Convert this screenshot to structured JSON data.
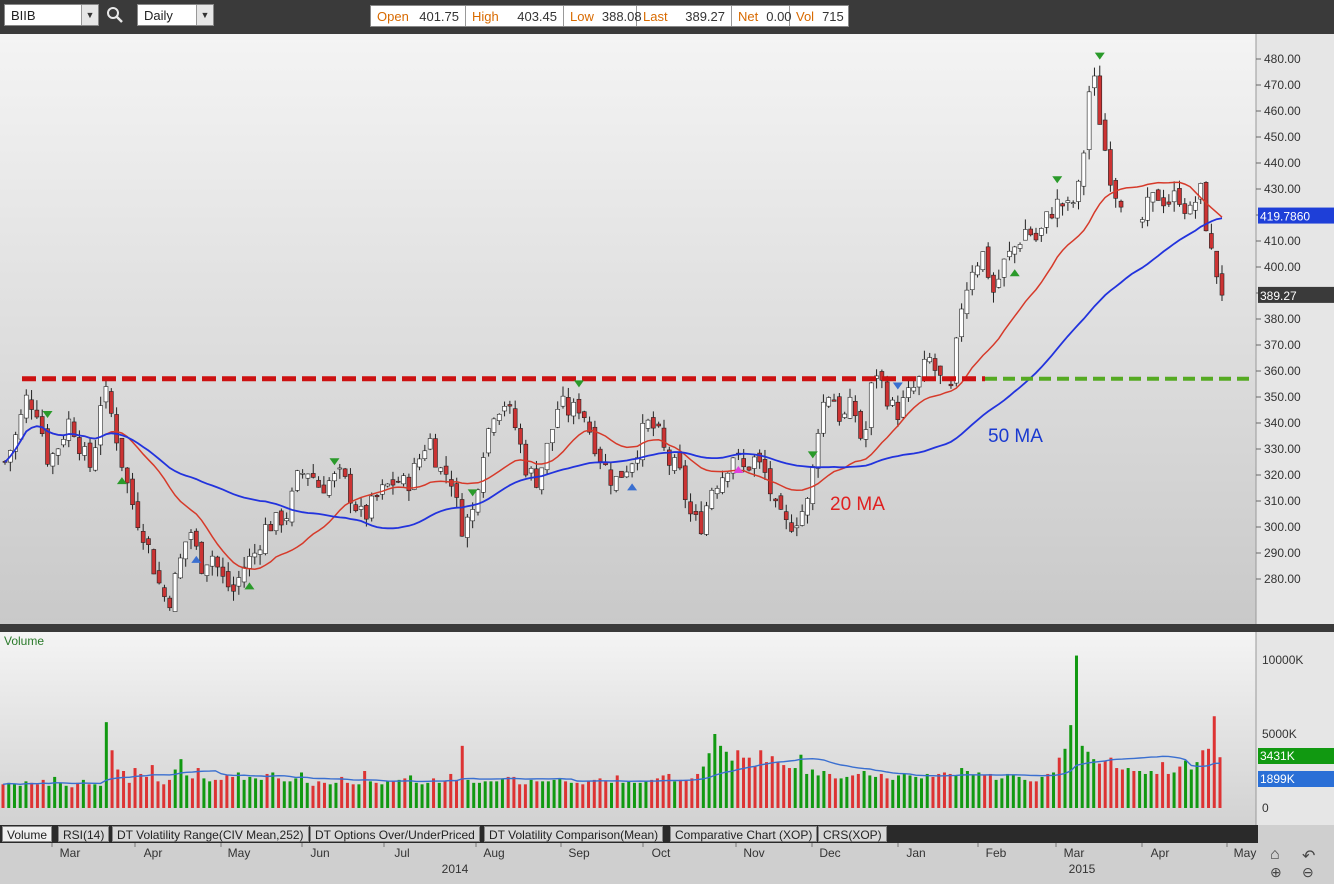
{
  "toolbar": {
    "symbol": "BIIB",
    "period": "Daily",
    "quote": [
      {
        "label": "Open",
        "value": "401.75"
      },
      {
        "label": "High",
        "value": "403.45"
      },
      {
        "label": "Low",
        "value": "388.08"
      },
      {
        "label": "Last",
        "value": "389.27"
      },
      {
        "label": "Net",
        "value": "0.00"
      },
      {
        "label": "Vol",
        "value": "715"
      }
    ]
  },
  "colors": {
    "up": "#ffffff",
    "down": "#cc3333",
    "ma20": "#d63a2a",
    "ma50": "#2233dd",
    "resistance": "#cc1111",
    "support": "#55aa22",
    "vol_up": "#119911",
    "vol_down": "#dd3333"
  },
  "tabs": [
    "Volume",
    "RSI(14)",
    "DT Volatility Range(CIV Mean,252)",
    "DT Options Over/UnderPriced",
    "DT Volatility Comparison(Mean)",
    "Comparative Chart (XOP)",
    "CRS(XOP)"
  ],
  "chart_data": [
    {
      "type": "candlestick",
      "title": "",
      "yaxis": {
        "ticks": [
          "480.00",
          "470.00",
          "460.00",
          "450.00",
          "440.00",
          "430.00",
          "420.00",
          "410.00",
          "400.00",
          "390.00",
          "380.00",
          "370.00",
          "360.00",
          "350.00",
          "340.00",
          "330.00",
          "320.00",
          "310.00",
          "300.00",
          "290.00",
          "280.00"
        ],
        "range": [
          270,
          486
        ]
      },
      "xaxis": {
        "months": [
          "Mar",
          "Apr",
          "May",
          "Jun",
          "Jul",
          "Aug",
          "Sep",
          "Oct",
          "Nov",
          "Dec",
          "Jan",
          "Feb",
          "Mar",
          "Apr",
          "May"
        ],
        "years": [
          "2014",
          "2015"
        ]
      },
      "price_labels": {
        "ma_value": "419.7860",
        "last": "389.27"
      },
      "annotations": {
        "ma20": "20 MA",
        "ma50": "50 MA"
      },
      "levels": {
        "resistance": 357,
        "support": 357
      },
      "path_points": [
        325,
        335,
        350,
        345,
        325,
        332,
        342,
        330,
        322,
        355,
        340,
        320,
        305,
        295,
        280,
        270,
        285,
        300,
        285,
        290,
        280,
        275,
        285,
        290,
        300,
        302,
        305,
        320,
        322,
        315,
        318,
        320,
        310,
        303,
        310,
        315,
        318,
        316,
        325,
        335,
        322,
        320,
        300,
        305,
        330,
        345,
        348,
        338,
        322,
        318,
        332,
        348,
        344,
        347,
        335,
        325,
        317,
        322,
        328,
        340,
        337,
        325,
        322,
        305,
        300,
        315,
        320,
        328,
        322,
        326,
        320,
        305,
        300,
        304,
        310,
        345,
        353,
        340,
        348,
        330,
        362,
        352,
        343,
        350,
        355,
        365,
        357,
        350,
        385,
        400,
        405,
        390,
        402,
        408,
        415,
        410,
        420,
        425,
        422,
        432,
        478,
        450,
        430,
        425,
        410,
        422,
        428,
        425,
        428,
        420,
        430,
        405,
        391
      ],
      "volume": {
        "yaxis_ticks": [
          "10000K",
          "5000K",
          "0"
        ],
        "labels": {
          "current": "3431K",
          "average": "1899K"
        },
        "values": [
          1600,
          1700,
          1600,
          1500,
          1800,
          1700,
          1600,
          1900,
          1500,
          2100,
          1700,
          1500,
          1400,
          1700,
          1900,
          1600,
          1600,
          1500,
          5800,
          3900,
          2600,
          2500,
          1700,
          2700,
          2300,
          2100,
          2900,
          1800,
          1600,
          1900,
          2600,
          3300,
          2200,
          2000,
          2700,
          2000,
          1800,
          1900,
          1900,
          2200,
          2100,
          2400,
          1900,
          2100,
          2000,
          1900,
          2300,
          2400,
          2000,
          1800,
          1800,
          2000,
          2400,
          1700,
          1500,
          1800,
          1700,
          1600,
          1700,
          2100,
          1700,
          1600,
          1600,
          2500,
          1800,
          1700,
          1600,
          1800,
          1800,
          1900,
          2000,
          2200,
          1700,
          1600,
          1700,
          2000,
          1700,
          1800,
          2300,
          1900,
          4200,
          1900,
          1700,
          1700,
          1800,
          1800,
          1800,
          2000,
          2100,
          2100,
          1600,
          1600,
          1900,
          1800,
          1800,
          1800,
          1900,
          2000,
          1800,
          1700,
          1700,
          1600,
          1800,
          1900,
          2000,
          1800,
          1700,
          2200,
          1700,
          1800,
          1700,
          1700,
          1800,
          1900,
          2000,
          2200,
          2300,
          1800,
          1900,
          1900,
          2000,
          2300,
          2800,
          3700,
          5000,
          4200,
          3800,
          3200,
          3900,
          3400,
          3400,
          2800,
          3900,
          3100,
          3500,
          3100,
          2900,
          2700,
          2700,
          3600,
          2300,
          2600,
          2200,
          2500,
          2300,
          2000,
          2000,
          2100,
          2200,
          2300,
          2500,
          2200,
          2100,
          2300,
          2000,
          1900,
          2200,
          2300,
          2200,
          2100,
          2000,
          2300,
          2100,
          2300,
          2400,
          2300,
          2200,
          2700,
          2500,
          2200,
          2400,
          2200,
          2300,
          1900,
          2000,
          2300,
          2200,
          2100,
          1900,
          1800,
          1800,
          2100,
          2300,
          2400,
          3400,
          4000,
          5600,
          10300,
          4200,
          3800,
          3300,
          3000,
          3200,
          3400,
          2700,
          2600,
          2700,
          2500,
          2500,
          2300,
          2500,
          2300,
          3100,
          2300,
          2400,
          2800,
          3200,
          2600,
          3100,
          3900,
          4000,
          6200,
          3431
        ]
      }
    }
  ]
}
